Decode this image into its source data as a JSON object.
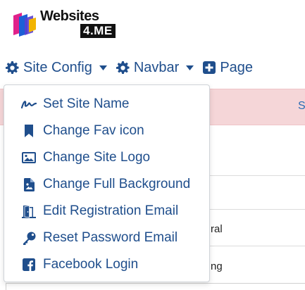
{
  "logo": {
    "line1": "Websites",
    "line2": "4.ME"
  },
  "topnav": {
    "items": [
      {
        "label": "Site Config",
        "icon": "gear-icon"
      },
      {
        "label": "Navbar",
        "icon": "gear-icon"
      },
      {
        "label": "Page",
        "icon": "plus-square-icon"
      }
    ]
  },
  "background": {
    "alert_link": "Se",
    "row_text_1": "ral",
    "row_text_2": "ng"
  },
  "dropdown": {
    "items": [
      {
        "label": "Set Site Name",
        "icon": "signature-icon"
      },
      {
        "label": "Change Fav icon",
        "icon": "bookmark-icon"
      },
      {
        "label": "Change Site Logo",
        "icon": "image-icon"
      },
      {
        "label": "Change Full Background",
        "icon": "file-image-icon"
      },
      {
        "label": "Edit Registration Email",
        "icon": "door-open-icon"
      },
      {
        "label": "Reset Password Email",
        "icon": "key-icon"
      },
      {
        "label": "Facebook Login",
        "icon": "facebook-icon"
      }
    ]
  },
  "colors": {
    "link": "#1f4e8c",
    "alert_bg": "#f5d6d8"
  }
}
